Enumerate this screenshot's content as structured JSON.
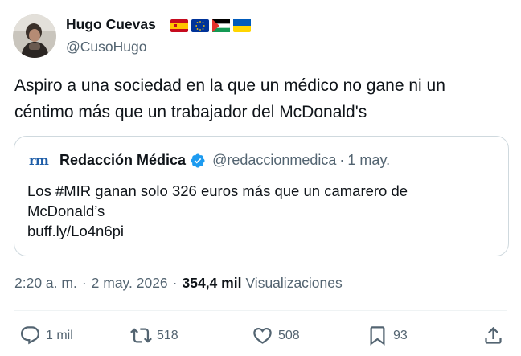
{
  "author": {
    "name": "Hugo Cuevas",
    "handle": "@CusoHugo",
    "flags": [
      "spain-flag-icon",
      "eu-flag-icon",
      "palestine-flag-icon",
      "ukraine-flag-icon"
    ]
  },
  "tweet": {
    "text": "Aspiro a una sociedad en la que un médico no gane ni un céntimo más que un trabajador del McDonald's"
  },
  "quote": {
    "logo": "rm",
    "name": "Redacción Médica",
    "handle": "@redaccionmedica",
    "separator": "·",
    "date": "1 may.",
    "lines": [
      "Los #MIR ganan solo 326 euros más que un camarero de",
      "McDonald’s",
      "buff.ly/Lo4n6pi"
    ]
  },
  "meta": {
    "time": "2:20 a. m.",
    "dot1": "·",
    "date": "2 may. 2026",
    "dot2": "·",
    "views_count": "354,4 mil",
    "views_label": "Visualizaciones"
  },
  "actions": {
    "replies": "1 mil",
    "reposts": "518",
    "likes": "508",
    "bookmarks": "93"
  },
  "colors": {
    "text": "#0f1419",
    "secondary": "#536471",
    "border": "#cfd9de",
    "verified": "#1d9bf0"
  }
}
